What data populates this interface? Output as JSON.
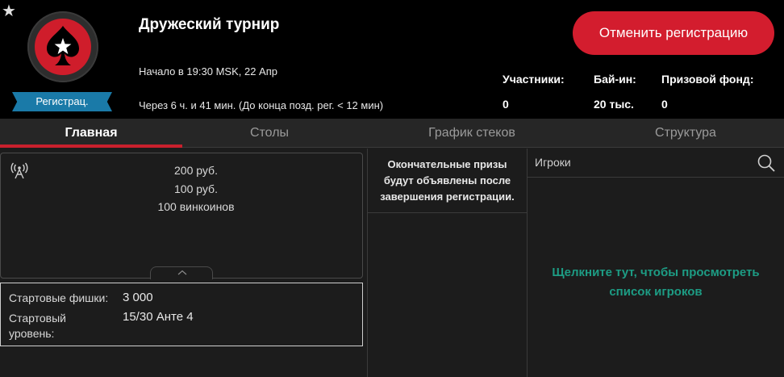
{
  "header": {
    "title": "Дружеский турнир",
    "start_text": "Начало в 19:30 MSK, 22 Апр",
    "remaining_text": "Через 6 ч. и 41 мин. (До конца позд. рег. < 12 мин)",
    "status_ribbon": "Регистрац.",
    "cancel_button": "Отменить регистрацию",
    "stats": {
      "players_label": "Участники:",
      "players_value": "0",
      "buyin_label": "Бай-ин:",
      "buyin_value": "20 тыс.",
      "prizepool_label": "Призовой фонд:",
      "prizepool_value": "0"
    }
  },
  "tabs": [
    {
      "label": "Главная",
      "active": true
    },
    {
      "label": "Столы",
      "active": false
    },
    {
      "label": "График стеков",
      "active": false
    },
    {
      "label": "Структура",
      "active": false
    }
  ],
  "prizes": [
    "200 руб.",
    "100 руб.",
    "100 винкоинов"
  ],
  "info": {
    "chips_label": "Стартовые фишки:",
    "chips_value": "3 000",
    "level_label_1": "Стартовый",
    "level_label_2": "уровень:",
    "level_value": "15/30 Анте 4"
  },
  "middle": {
    "note_line1": "Окончательные призы",
    "note_line2": "будут объявлены после",
    "note_line3": "завершения регистрации."
  },
  "players": {
    "search_placeholder": "Игроки",
    "link_line1": "Щелкните тут, чтобы просмотреть",
    "link_line2": "список игроков"
  },
  "colors": {
    "accent_red": "#d31d2e",
    "ribbon_blue": "#1a7aa8",
    "link_green": "#1d9c84"
  },
  "icons": [
    "star-icon",
    "pokerstars-logo",
    "antenna-icon",
    "chevron-up-icon",
    "search-icon"
  ]
}
